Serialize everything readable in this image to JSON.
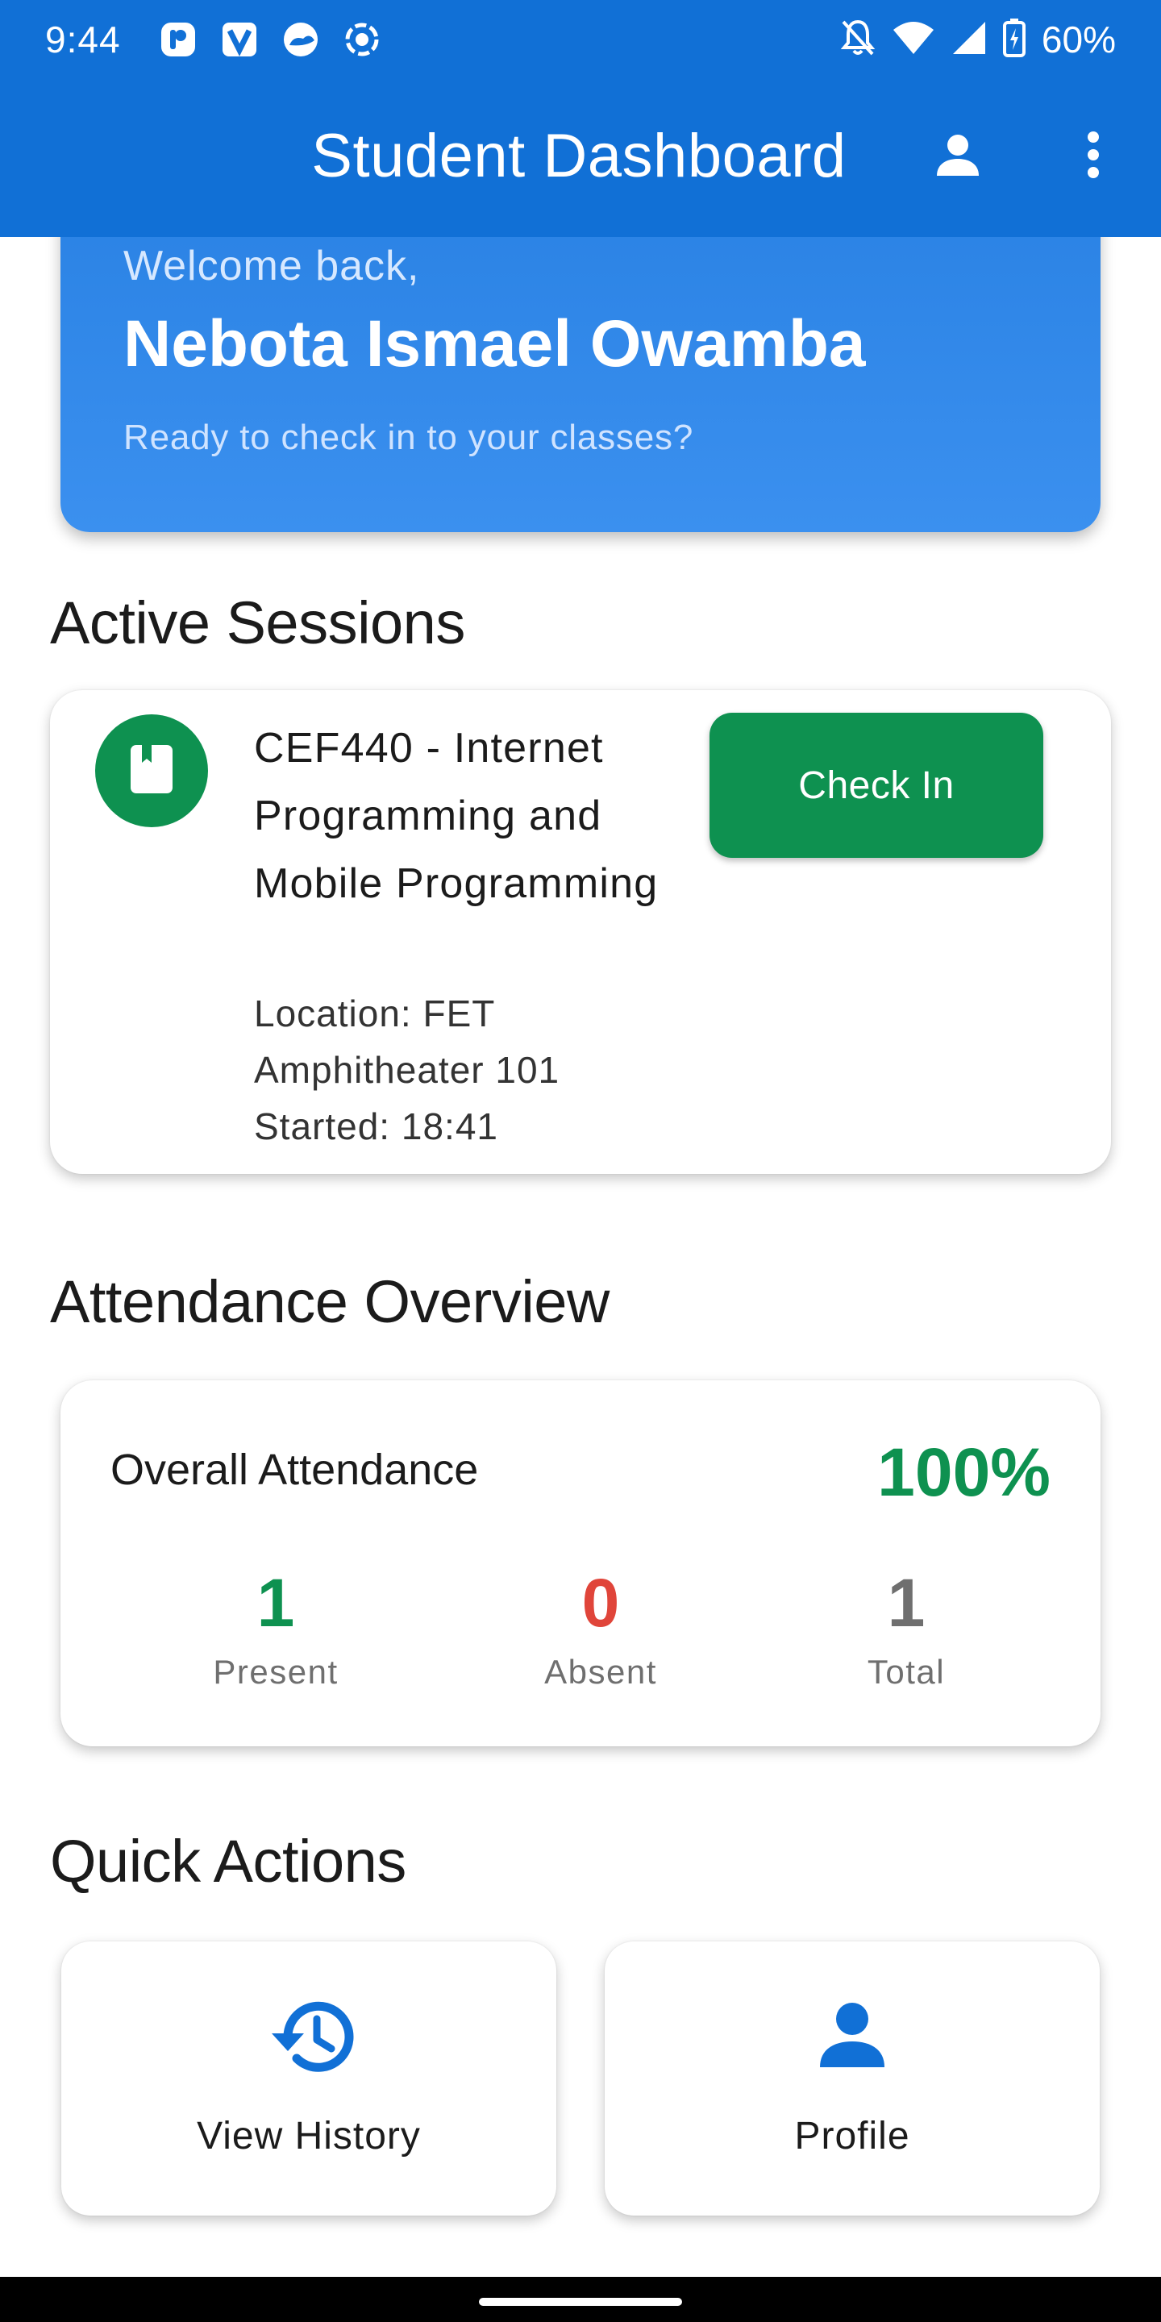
{
  "status_bar": {
    "time": "9:44",
    "battery": "60%",
    "left_icons": [
      "p-app-icon",
      "v-app-icon",
      "cloud-app-icon",
      "record-icon"
    ],
    "right_icons": [
      "bell-off-icon",
      "wifi-icon",
      "signal-icon",
      "battery-charging-icon"
    ]
  },
  "app_bar": {
    "title": "Student Dashboard",
    "profile_icon": "person-icon",
    "menu_icon": "more-vert-icon",
    "color": "#1170d6"
  },
  "welcome": {
    "greeting": "Welcome back,",
    "name": "Nebota Ismael Owamba",
    "subtitle": "Ready to check in to your classes?"
  },
  "active_sessions": {
    "heading": "Active Sessions",
    "sessions": [
      {
        "icon": "book-icon",
        "title": "CEF440 - Internet Programming and Mobile Programming",
        "location": "Location: FET Amphitheater 101",
        "started": "Started: 18:41",
        "action_label": "Check In"
      }
    ]
  },
  "attendance": {
    "heading": "Attendance Overview",
    "overall_label": "Overall Attendance",
    "overall_percent": "100%",
    "stats": [
      {
        "value": "1",
        "label": "Present",
        "color": "#0e9150"
      },
      {
        "value": "0",
        "label": "Absent",
        "color": "#e0453a"
      },
      {
        "value": "1",
        "label": "Total",
        "color": "#6f6f6f"
      }
    ]
  },
  "quick_actions": {
    "heading": "Quick Actions",
    "items": [
      {
        "label": "View History",
        "icon": "history-icon"
      },
      {
        "label": "Profile",
        "icon": "person-icon"
      }
    ]
  },
  "colors": {
    "primary": "#1170d6",
    "success": "#0e9150",
    "danger": "#e0453a"
  }
}
